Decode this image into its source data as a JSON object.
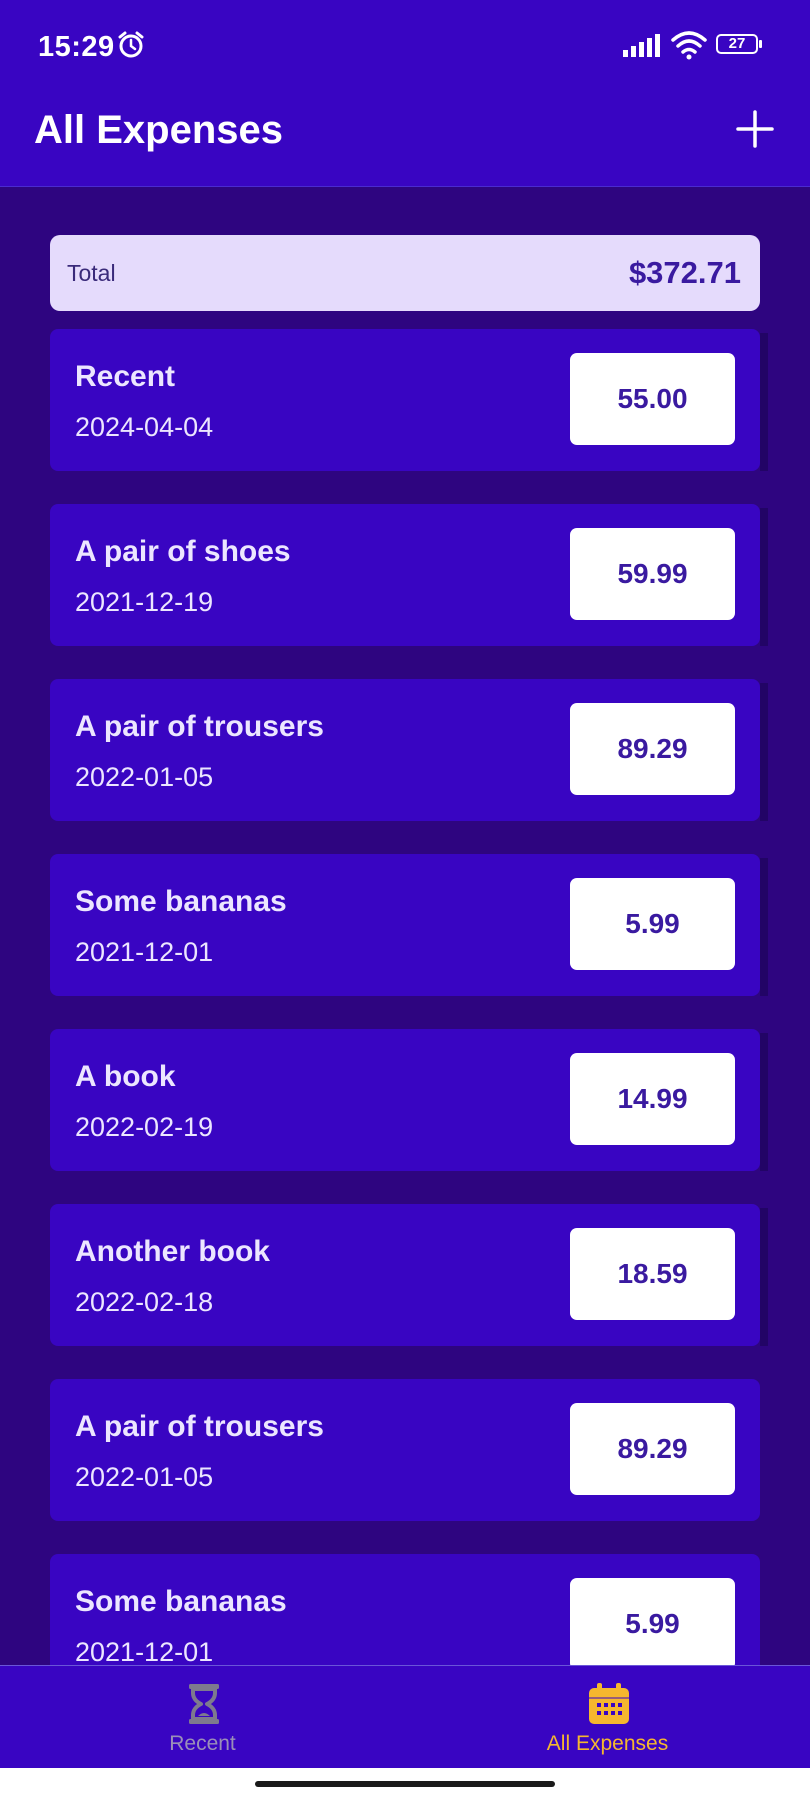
{
  "status_bar": {
    "time": "15:29",
    "battery": "27"
  },
  "app_bar": {
    "title": "All Expenses",
    "add_icon": "plus-icon"
  },
  "total": {
    "label": "Total",
    "value": "$372.71"
  },
  "expenses": [
    {
      "title": "Recent",
      "date": "2024-04-04",
      "amount": "55.00"
    },
    {
      "title": "A pair of shoes",
      "date": "2021-12-19",
      "amount": "59.99"
    },
    {
      "title": "A pair of trousers",
      "date": "2022-01-05",
      "amount": "89.29"
    },
    {
      "title": "Some bananas",
      "date": "2021-12-01",
      "amount": "5.99"
    },
    {
      "title": "A book",
      "date": "2022-02-19",
      "amount": "14.99"
    },
    {
      "title": "Another book",
      "date": "2022-02-18",
      "amount": "18.59"
    },
    {
      "title": "A pair of trousers",
      "date": "2022-01-05",
      "amount": "89.29"
    },
    {
      "title": "Some bananas",
      "date": "2021-12-01",
      "amount": "5.99"
    }
  ],
  "bottom_nav": {
    "tabs": [
      {
        "label": "Recent",
        "icon": "hourglass-icon",
        "active": false
      },
      {
        "label": "All Expenses",
        "icon": "calendar-icon",
        "active": true
      }
    ]
  },
  "colors": {
    "primary": "#3905C2",
    "background": "#2E0580",
    "total_card": "#E5DBFC",
    "active_tab": "#F5B72E",
    "inactive_tab": "#9A8FB8"
  }
}
